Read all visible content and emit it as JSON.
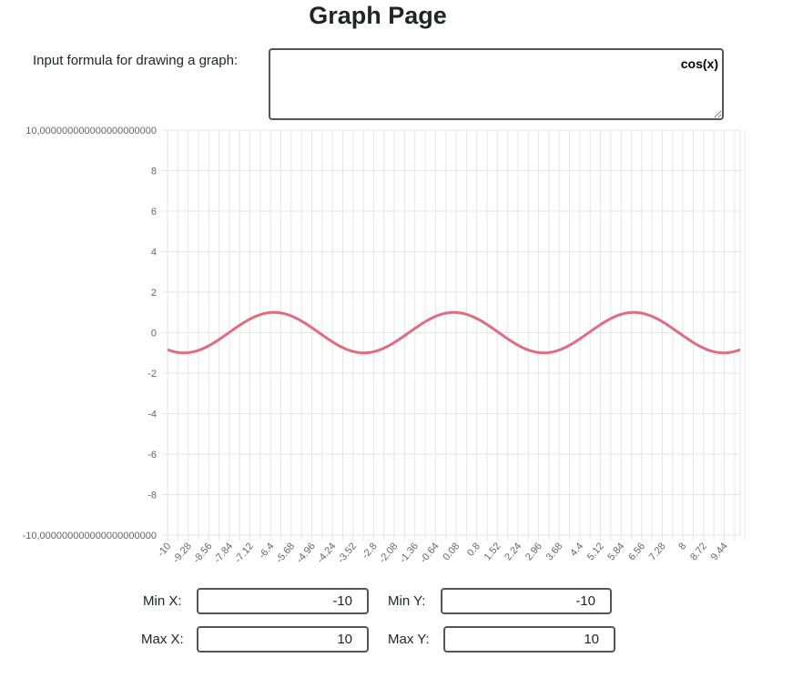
{
  "page": {
    "title": "Graph Page"
  },
  "formula": {
    "label": "Input formula for drawing a graph:",
    "value": "cos(x)"
  },
  "chart_data": {
    "type": "line",
    "formula": "cos(x)",
    "y_tick_labels": [
      "10,000000000000000000000",
      "8",
      "6",
      "4",
      "2",
      "0",
      "-2",
      "-4",
      "-6",
      "-8",
      "-10,000000000000000000000"
    ],
    "x_tick_labels": [
      "-10",
      "-9.28",
      "-8.56",
      "-7.84",
      "-7.12",
      "-6.4",
      "-5.68",
      "-4.96",
      "-4.24",
      "-3.52",
      "-2.8",
      "-2.08",
      "-1.36",
      "-0.64",
      "0.08",
      "0.8",
      "1.52",
      "2.24",
      "2.96",
      "3.68",
      "4.4",
      "5.12",
      "5.84",
      "6.56",
      "7.28",
      "8",
      "8.72",
      "9.44"
    ],
    "x_range": [
      -10,
      10
    ],
    "ylim": [
      -10,
      10
    ],
    "x_step": 0.36,
    "grid": true,
    "series": [
      {
        "color": "#e06c82"
      }
    ]
  },
  "fields": {
    "min_x": {
      "label": "Min X:",
      "value": "-10"
    },
    "min_y": {
      "label": "Min Y:",
      "value": "-10"
    },
    "max_x": {
      "label": "Max X:",
      "value": "10"
    },
    "max_y": {
      "label": "Max Y:",
      "value": "10"
    }
  },
  "colors": {
    "line": "#e06c82",
    "grid": "#e6e6e6",
    "tick_text": "#666666",
    "input_border": "#555555"
  }
}
